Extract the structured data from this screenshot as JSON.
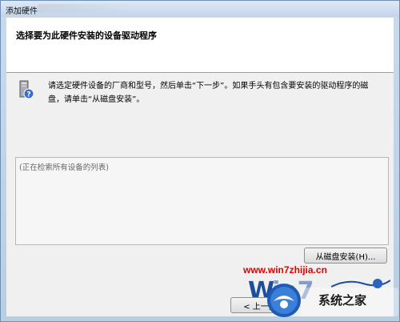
{
  "window": {
    "title": "添加硬件"
  },
  "header": {
    "title": "选择要为此硬件安装的设备驱动程序"
  },
  "content": {
    "description": "请选定硬件设备的厂商和型号，然后单击“下一步”。如果手头有包含要安装的驱动程序的磁盘，请单击“从磁盘安装”。",
    "list_placeholder": "(正在检索所有设备的列表)"
  },
  "buttons": {
    "have_disk": "从磁盘安装(H)...",
    "back": "< 上一步"
  },
  "watermark": {
    "url": "www.win7zhijia.cn",
    "logo_text": "Win7",
    "site_name": "系统之家"
  },
  "icons": [
    "hardware-icon",
    "question-icon"
  ],
  "colors": {
    "accent": "#e00000",
    "titlebar": "#c3d5ea"
  }
}
